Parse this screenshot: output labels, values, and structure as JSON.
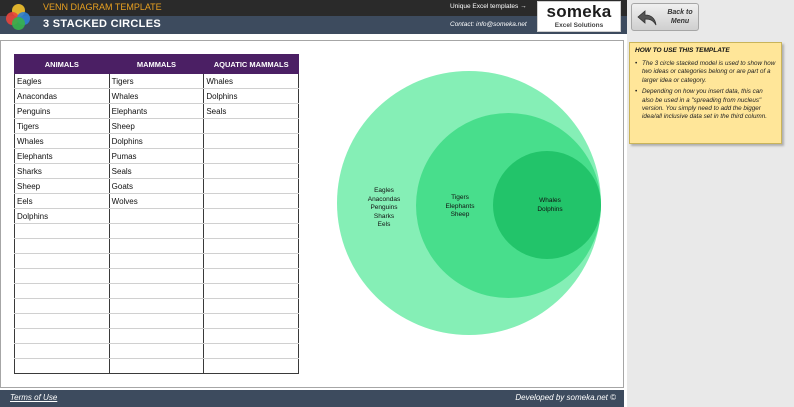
{
  "header": {
    "template_name": "VENN DIAGRAM TEMPLATE",
    "title": "3 STACKED CIRCLES",
    "link_text": "Unique Excel templates →",
    "contact": "Contact: info@someka.net",
    "brand_name": "someka",
    "brand_sub": "Excel Solutions",
    "back_button": "Back to Menu"
  },
  "table": {
    "headers": [
      "ANIMALS",
      "MAMMALS",
      "AQUATIC MAMMALS"
    ],
    "rows": [
      [
        "Eagles",
        "Tigers",
        "Whales"
      ],
      [
        "Anacondas",
        "Whales",
        "Dolphins"
      ],
      [
        "Penguins",
        "Elephants",
        "Seals"
      ],
      [
        "Tigers",
        "Sheep",
        ""
      ],
      [
        "Whales",
        "Dolphins",
        ""
      ],
      [
        "Elephants",
        "Pumas",
        ""
      ],
      [
        "Sharks",
        "Seals",
        ""
      ],
      [
        "Sheep",
        "Goats",
        ""
      ],
      [
        "Eels",
        "Wolves",
        ""
      ],
      [
        "Dolphins",
        "",
        ""
      ],
      [
        "",
        "",
        ""
      ],
      [
        "",
        "",
        ""
      ],
      [
        "",
        "",
        ""
      ],
      [
        "",
        "",
        ""
      ],
      [
        "",
        "",
        ""
      ],
      [
        "",
        "",
        ""
      ],
      [
        "",
        "",
        ""
      ],
      [
        "",
        "",
        ""
      ],
      [
        "",
        "",
        ""
      ],
      [
        "",
        "",
        ""
      ]
    ]
  },
  "venn": {
    "outer_items": [
      "Eagles",
      "Anacondas",
      "Penguins",
      "Sharks",
      "Eels"
    ],
    "middle_items": [
      "Tigers",
      "Elephants",
      "Sheep"
    ],
    "inner_items": [
      "Whales",
      "Dolphins"
    ],
    "colors": {
      "outer": "#85efb6",
      "middle": "#48de8c",
      "inner": "#22c46a"
    }
  },
  "instructions": {
    "title": "HOW TO USE THIS TEMPLATE",
    "bullets": [
      "The 3 circle stacked model is used to show how two ideas or categories belong or are part of a larger idea or category.",
      "Depending on how you insert data, this can also be used in a \"spreading from nucleus\" version. You simply need to add the bigger idea/all inclusive data set in the third column."
    ]
  },
  "footer": {
    "terms": "Terms of Use",
    "developed_by": "Developed by someka.net ©"
  },
  "colors": {
    "header_dark": "#2a2a2a",
    "header_blue": "#3d4b5e",
    "table_header": "#4b1f64",
    "template_name": "#e8a020",
    "note_bg": "#ffe699"
  }
}
